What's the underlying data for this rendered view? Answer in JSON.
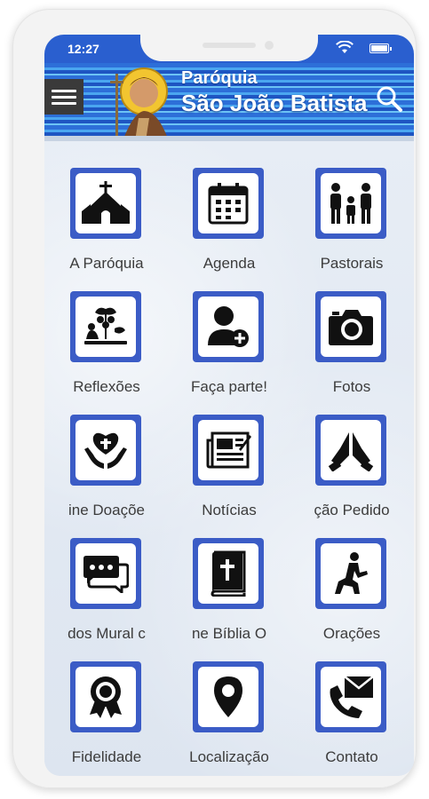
{
  "status": {
    "time": "12:27"
  },
  "header": {
    "title_top": "Paróquia",
    "title_main": "São João Batista"
  },
  "tiles": [
    {
      "label": "A Paróquia",
      "icon": "church-icon"
    },
    {
      "label": "Agenda",
      "icon": "calendar-icon"
    },
    {
      "label": "Pastorais",
      "icon": "family-icon"
    },
    {
      "label": "Reflexões",
      "icon": "plant-reading-icon"
    },
    {
      "label": "Faça parte!",
      "icon": "add-person-icon"
    },
    {
      "label": "Fotos",
      "icon": "camera-icon"
    },
    {
      "label": "ine   Doaçõe",
      "icon": "heart-hands-icon"
    },
    {
      "label": "Notícias",
      "icon": "newspaper-icon"
    },
    {
      "label": "ção   Pedido",
      "icon": "praying-hands-icon"
    },
    {
      "label": "dos   Mural c",
      "icon": "chat-bubbles-icon"
    },
    {
      "label": "ne   Bíblia O",
      "icon": "bible-icon"
    },
    {
      "label": "Orações",
      "icon": "kneeling-person-icon"
    },
    {
      "label": "Fidelidade",
      "icon": "medal-icon"
    },
    {
      "label": "Localização",
      "icon": "location-pin-icon"
    },
    {
      "label": "Contato",
      "icon": "phone-mail-icon"
    }
  ],
  "colors": {
    "accent": "#3b5cc6",
    "statusbar": "#2a5fcf"
  }
}
